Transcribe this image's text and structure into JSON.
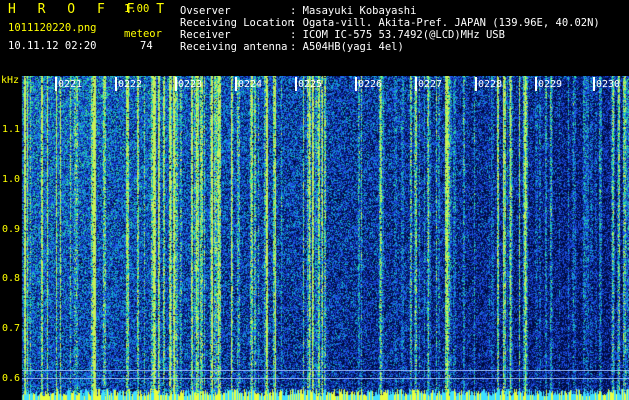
{
  "header": {
    "brand": "H R O F F T",
    "version": "1.00",
    "filename": "1011120220.png",
    "datetime": "10.11.12 02:20",
    "meteor_label": "meteor",
    "meteor_count": "74",
    "fields": [
      {
        "label": "Ovserver",
        "value": ": Masayuki Kobayashi"
      },
      {
        "label": "Receiving Location",
        "value": ": Ogata-vill. Akita-Pref. JAPAN (139.96E, 40.02N)"
      },
      {
        "label": "Receiver",
        "value": ": ICOM IC-575 53.7492(@LCD)MHz USB"
      },
      {
        "label": "Receiving antenna",
        "value": ": A504HB(yagi 4el)"
      }
    ]
  },
  "axis": {
    "unit": "kHz",
    "y_ticks": [
      "1.1",
      "1.0",
      "0.9",
      "0.8",
      "0.7",
      "0.6"
    ],
    "time_ticks": [
      "0221",
      "0222",
      "0223",
      "0224",
      "0225",
      "0226",
      "0227",
      "0228",
      "0229",
      "0230"
    ]
  },
  "colors": {
    "background": "#000000",
    "label_yellow": "#ffff00",
    "text_white": "#ffffff",
    "low": "#00205a",
    "mid": "#2050ff",
    "high": "#40ff90"
  }
}
